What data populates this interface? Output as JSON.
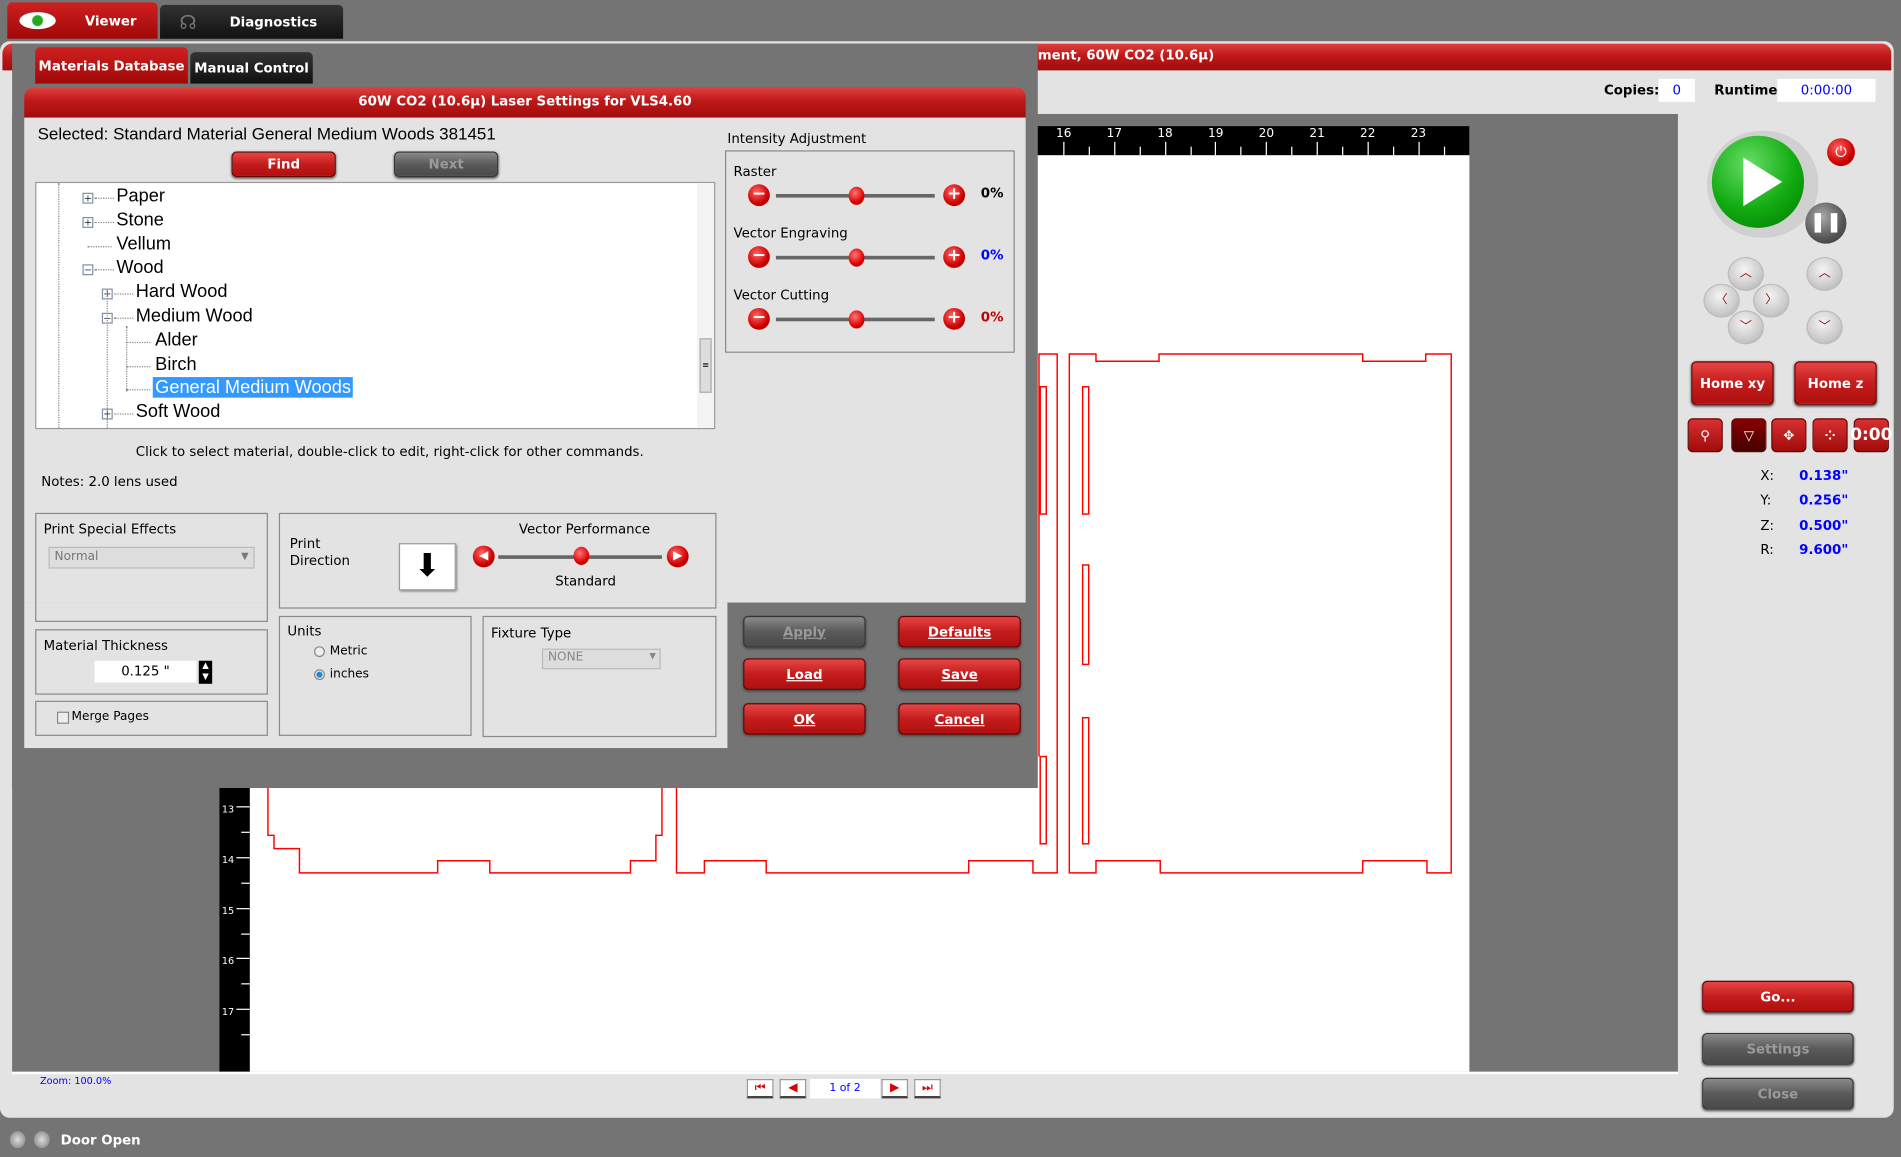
{
  "top_tabs": [
    {
      "label": "Viewer",
      "icon": "eye-icon"
    },
    {
      "label": "Diagnostics",
      "icon": "stethoscope-icon"
    }
  ],
  "main": {
    "title_fragment": "ment, 60W CO2 (10.6µ)",
    "copies_label": "Copies:",
    "copies_value": "0",
    "runtime_label": "Runtime:",
    "runtime_value": "0:00:00",
    "ruler_top": [
      "16",
      "17",
      "18",
      "19",
      "20",
      "21",
      "22",
      "23"
    ],
    "ruler_left": [
      "13",
      "14",
      "15",
      "16",
      "17"
    ],
    "zoom": "Zoom:  100.0%",
    "page": "1 of 2"
  },
  "dialog": {
    "tabs": [
      {
        "label": "Materials Database"
      },
      {
        "label": "Manual Control"
      }
    ],
    "title": "60W CO2 (10.6µ) Laser Settings for VLS4.60",
    "selected": "Selected: Standard Material General Medium Woods 381451",
    "find": "Find",
    "next": "Next",
    "tree": [
      {
        "label": "Paper",
        "level": 0,
        "toggle": "+"
      },
      {
        "label": "Stone",
        "level": 0,
        "toggle": "+"
      },
      {
        "label": "Vellum",
        "level": 0,
        "toggle": ""
      },
      {
        "label": "Wood",
        "level": 0,
        "toggle": "-"
      },
      {
        "label": "Hard Wood",
        "level": 1,
        "toggle": "+"
      },
      {
        "label": "Medium Wood",
        "level": 1,
        "toggle": "-"
      },
      {
        "label": "Alder",
        "level": 2,
        "toggle": ""
      },
      {
        "label": "Birch",
        "level": 2,
        "toggle": ""
      },
      {
        "label": "General Medium Woods",
        "level": 2,
        "toggle": "",
        "selected": true
      },
      {
        "label": "Soft Wood",
        "level": 1,
        "toggle": "+"
      }
    ],
    "hint": "Click to select material, double-click to edit, right-click for other commands.",
    "notes": "Notes: 2.0 lens used",
    "intensity": {
      "title": "Intensity Adjustment",
      "rows": [
        {
          "label": "Raster",
          "value": "0%",
          "color": "#000000",
          "level": 0.5
        },
        {
          "label": "Vector Engraving",
          "value": "0%",
          "color": "#0000ff",
          "level": 0.5
        },
        {
          "label": "Vector Cutting",
          "value": "0%",
          "color": "#c00000",
          "level": 0.5
        }
      ]
    },
    "effects": {
      "title": "Print Special Effects",
      "value": "Normal"
    },
    "thickness": {
      "title": "Material Thickness",
      "value": "0.125 \""
    },
    "merge": {
      "label": "Merge Pages",
      "checked": false
    },
    "direction": {
      "title1": "Print",
      "title2": "Direction"
    },
    "performance": {
      "title": "Vector Performance",
      "value": "Standard",
      "level": 0.5
    },
    "units": {
      "title": "Units",
      "options": [
        "Metric",
        "inches"
      ],
      "selected": "inches"
    },
    "fixture": {
      "title": "Fixture Type",
      "value": "NONE"
    },
    "buttons": {
      "apply": "Apply",
      "defaults": "Defaults",
      "load": "Load",
      "save": "Save",
      "ok": "OK",
      "cancel": "Cancel"
    }
  },
  "control": {
    "home_xy": "Home xy",
    "home_z": "Home z",
    "timer": "0:00",
    "coords": [
      {
        "axis": "X:",
        "value": "0.138\""
      },
      {
        "axis": "Y:",
        "value": "0.256\""
      },
      {
        "axis": "Z:",
        "value": "0.500\""
      },
      {
        "axis": "R:",
        "value": "9.600\""
      }
    ],
    "go": "Go...",
    "settings": "Settings",
    "close": "Close"
  },
  "status": {
    "text": "Door Open"
  },
  "colors": {
    "accent": "#c41c1c",
    "cut_line": "#ff0000",
    "coord_value": "#0000ff"
  }
}
